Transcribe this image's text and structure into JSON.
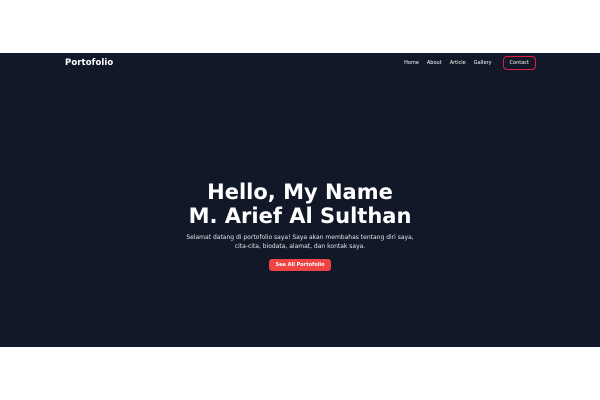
{
  "navbar": {
    "brand": "Portofolio",
    "links": [
      "Home",
      "About",
      "Article",
      "Gallery"
    ],
    "contact": "Contact"
  },
  "hero": {
    "title_line1": "Hello, My Name",
    "title_line2": "M. Arief Al Sulthan",
    "subtitle": "Selamat datang di portofolio saya! Saya akan membahas tentang diri saya, cita-cita, biodata, alamat, dan kontak saya.",
    "cta": "See All Portofolio"
  },
  "colors": {
    "background": "#111827",
    "accent": "#ef4444",
    "contact_border": "#e11d48"
  }
}
